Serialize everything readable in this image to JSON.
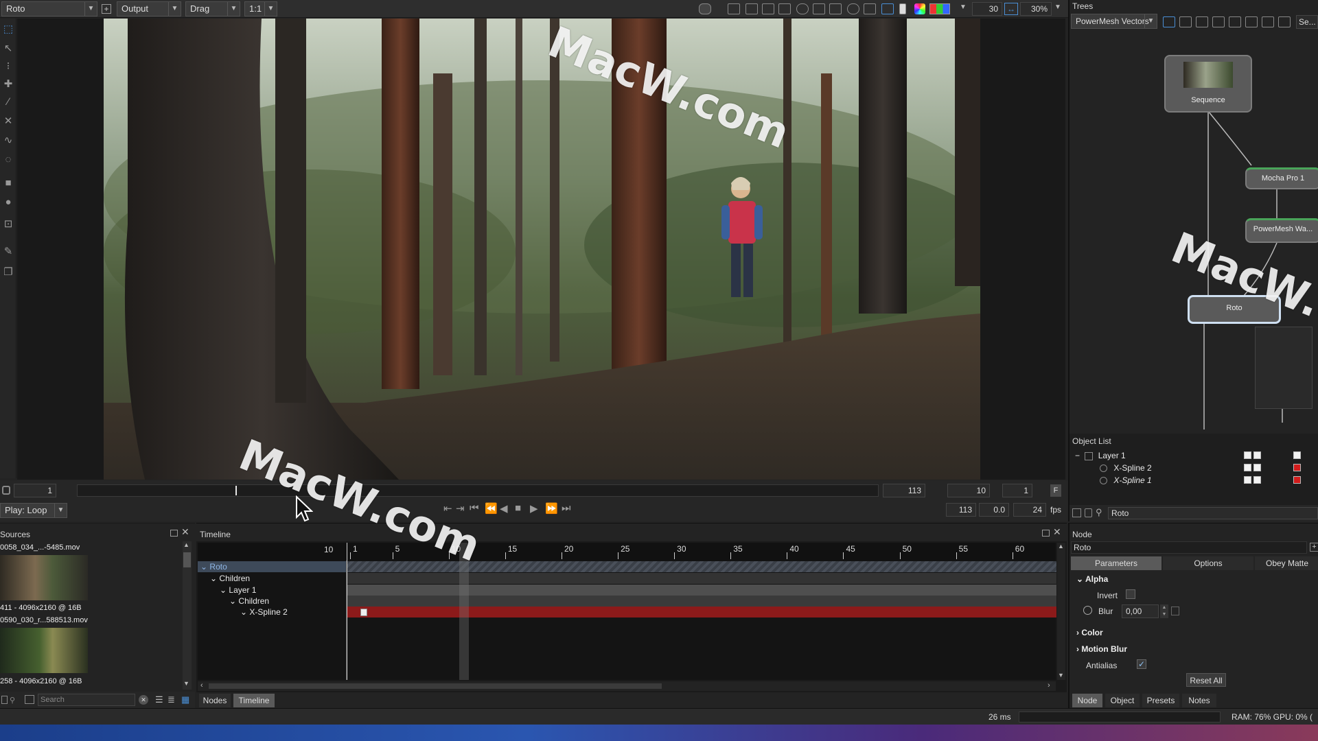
{
  "toolbar": {
    "module": "Roto",
    "view": "Output",
    "tool_mode": "Drag",
    "scale": "1:1",
    "frame_step": "30",
    "zoom": "30%"
  },
  "viewer": {
    "frame_in": "1",
    "frame_out": "113",
    "step_a": "10",
    "step_b": "1",
    "end_frame": "113",
    "offset": "0.0",
    "fps": "24",
    "fps_unit": "fps",
    "play_mode": "Play: Loop",
    "flag": "F"
  },
  "sources": {
    "title": "Sources",
    "items": [
      {
        "name": "0058_034_...-5485.mov",
        "info": "411 - 4096x2160 @ 16B"
      },
      {
        "name": "0590_030_r...588513.mov",
        "info": "258 - 4096x2160 @ 16B"
      }
    ],
    "search_placeholder": "Search"
  },
  "timeline": {
    "title": "Timeline",
    "current_frame": "10",
    "ticks": [
      "1",
      "5",
      "10",
      "15",
      "20",
      "25",
      "30",
      "35",
      "40",
      "45",
      "50",
      "55",
      "60"
    ],
    "rows": [
      {
        "label": "Roto"
      },
      {
        "label": "Children"
      },
      {
        "label": "Layer 1"
      },
      {
        "label": "Children"
      },
      {
        "label": "X-Spline 2"
      }
    ],
    "tabs": [
      "Nodes",
      "Timeline"
    ]
  },
  "trees": {
    "title": "Trees",
    "filter": "PowerMesh Vectors",
    "search_short": "Se...",
    "nodes": [
      "Sequence",
      "Mocha Pro 1",
      "PowerMesh Wa...",
      "Roto"
    ]
  },
  "object_list": {
    "title": "Object List",
    "items": [
      "Layer 1",
      "X-Spline 2",
      "X-Spline 1"
    ],
    "search_value": "Roto"
  },
  "node_panel": {
    "title": "Node",
    "node_name": "Roto",
    "tabs": [
      "Parameters",
      "Options",
      "Obey Matte"
    ],
    "section_alpha": "Alpha",
    "invert_label": "Invert",
    "blur_label": "Blur",
    "blur_value": "0,00",
    "section_color": "Color",
    "section_motion_blur": "Motion Blur",
    "antialias_label": "Antialias",
    "reset_label": "Reset All",
    "bottom_tabs": [
      "Node",
      "Object",
      "Presets",
      "Notes"
    ]
  },
  "status": {
    "render_time": "26 ms",
    "resources": "RAM: 76% GPU: 0% ("
  },
  "watermark": "MacW.com",
  "colors": {
    "accent_blue": "#4a8fd6",
    "spline_red": "#8c1a1a",
    "roto_row": "#3e4a5a"
  }
}
